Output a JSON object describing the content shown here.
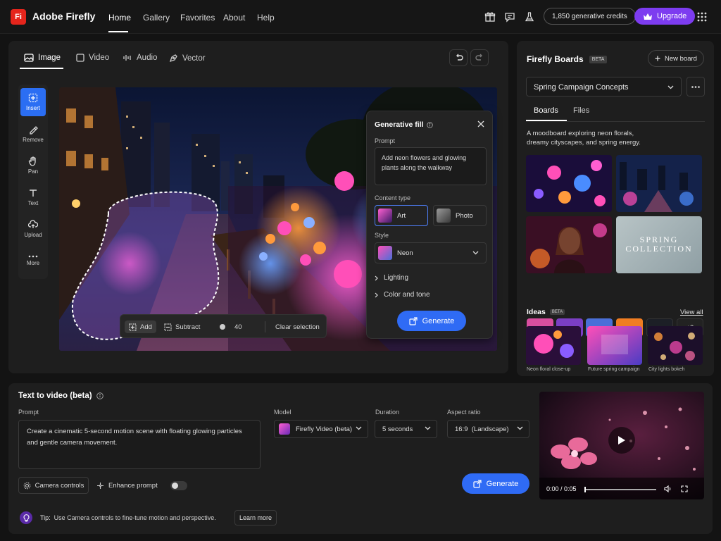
{
  "app": {
    "logo_text": "Fi",
    "name": "Adobe Firefly"
  },
  "nav": {
    "items": [
      {
        "label": "Home",
        "active": true
      },
      {
        "label": "Gallery"
      },
      {
        "label": "Favorites"
      },
      {
        "label": "About"
      },
      {
        "label": "Help"
      }
    ]
  },
  "header": {
    "credits": "1,850 generative credits",
    "upgrade": "Upgrade"
  },
  "editor": {
    "tabs": [
      "Image",
      "Video",
      "Audio",
      "Vector"
    ],
    "active_tab": "Image",
    "tools": [
      "Insert",
      "Remove",
      "Pan",
      "Text",
      "Upload",
      "More"
    ],
    "active_tool": "Insert"
  },
  "selection_toolbar": {
    "add": "Add",
    "subtract": "Subtract",
    "brush_size": "40",
    "clear": "Clear selection"
  },
  "generative_fill": {
    "title": "Generative fill",
    "prompt_label": "Prompt",
    "prompt_value": "Add neon flowers and glowing plants along the walkway",
    "content_type_label": "Content type",
    "content_types": [
      "Art",
      "Photo"
    ],
    "selected_content_type": "Art",
    "style_label": "Style",
    "style_value": "Neon",
    "lighting": "Lighting",
    "color_tone": "Color and tone",
    "generate": "Generate"
  },
  "boards": {
    "title": "Firefly Boards",
    "badge": "BETA",
    "new_board": "New board",
    "selected_board": "Spring Campaign Concepts",
    "tabs": [
      "Boards",
      "Files"
    ],
    "active_tab": "Boards",
    "description": "A moodboard exploring neon florals, dreamy cityscapes, and spring energy.",
    "card_text": {
      "line1": "SPRING",
      "line2": "COLLECTION"
    },
    "swatches": [
      "#d94ea0",
      "#7b3fc4",
      "#4a6fd8",
      "#f07d22",
      "#1c1f26"
    ],
    "swatch_more": "+8",
    "ideas_title": "Ideas",
    "ideas_badge": "BETA",
    "view_all": "View all",
    "ideas": [
      "Neon floral close-up",
      "Future spring campaign",
      "City lights bokeh"
    ]
  },
  "text_to_video": {
    "title": "Text to video (beta)",
    "prompt_label": "Prompt",
    "prompt_value": "Create a cinematic 5-second motion scene with floating glowing particles and gentle camera movement.",
    "model_label": "Model",
    "model_value": "Firefly Video (beta)",
    "duration_label": "Duration",
    "duration_value": "5 seconds",
    "aspect_label": "Aspect ratio",
    "aspect_value": "16:9  (Landscape)",
    "camera_controls": "Camera controls",
    "enhance_prompt": "Enhance prompt",
    "enhance_on": false,
    "generate": "Generate",
    "video_time": "0:00 / 0:05"
  },
  "tip": {
    "label": "Tip:",
    "text": "Use Camera controls to fine-tune motion and perspective.",
    "learn_more": "Learn more"
  }
}
